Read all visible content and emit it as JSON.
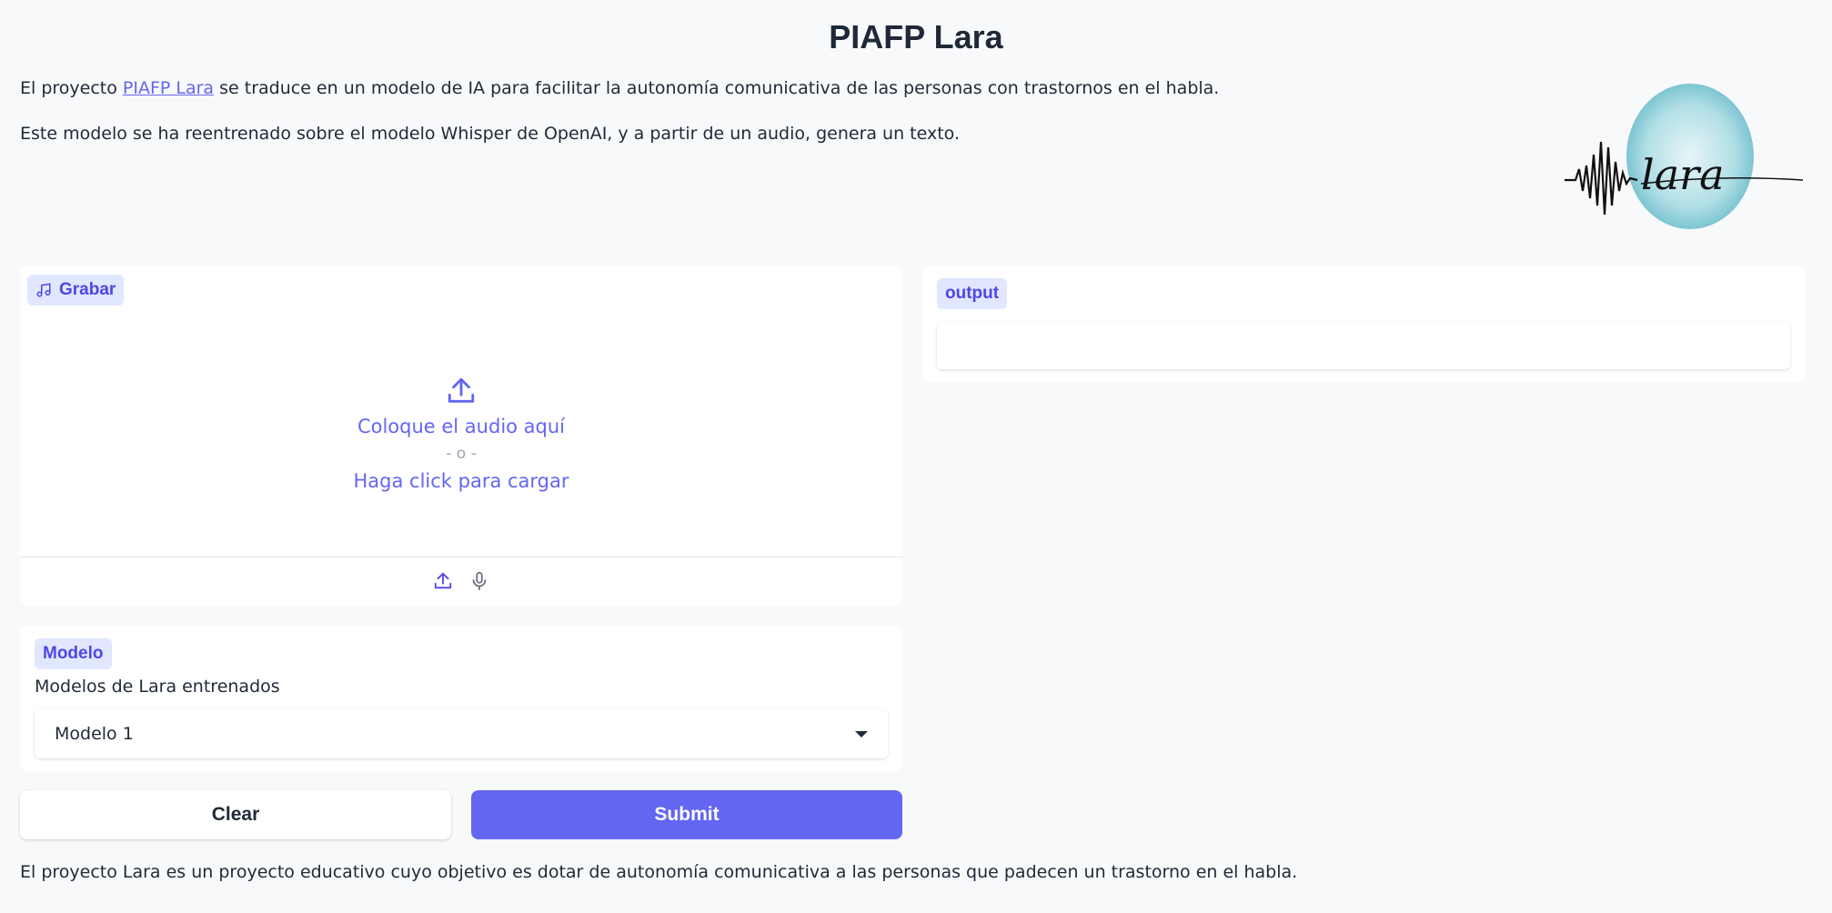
{
  "header": {
    "title": "PIAFP Lara"
  },
  "intro": {
    "line1_prefix": "El proyecto ",
    "line1_link": "PIAFP Lara",
    "line1_suffix": " se traduce en un modelo de IA para facilitar la autonomía comunicativa de las personas con trastornos en el habla.",
    "line2": "Este modelo se ha reentrenado sobre el modelo Whisper de OpenAI, y a partir de un audio, genera un texto."
  },
  "logo": {
    "text": "lara",
    "accent_color": "#7ec8d3"
  },
  "audio_input": {
    "label": "Grabar",
    "label_icon": "music-note-icon",
    "drop_text": "Coloque el audio aquí",
    "or_text": "- o -",
    "click_text": "Haga click para cargar",
    "upload_icon": "upload-icon",
    "mic_icon": "microphone-icon"
  },
  "model": {
    "label": "Modelo",
    "description": "Modelos de Lara entrenados",
    "selected": "Modelo 1"
  },
  "buttons": {
    "clear": "Clear",
    "submit": "Submit"
  },
  "output": {
    "label": "output",
    "value": ""
  },
  "footer": {
    "text": "El proyecto Lara es un proyecto educativo cuyo objetivo es dotar de autonomía comunicativa a las personas que padecen un trastorno en el habla."
  },
  "colors": {
    "accent": "#6366f1",
    "chip_bg": "#e0e7ff",
    "page_bg": "#f8f9fb"
  }
}
